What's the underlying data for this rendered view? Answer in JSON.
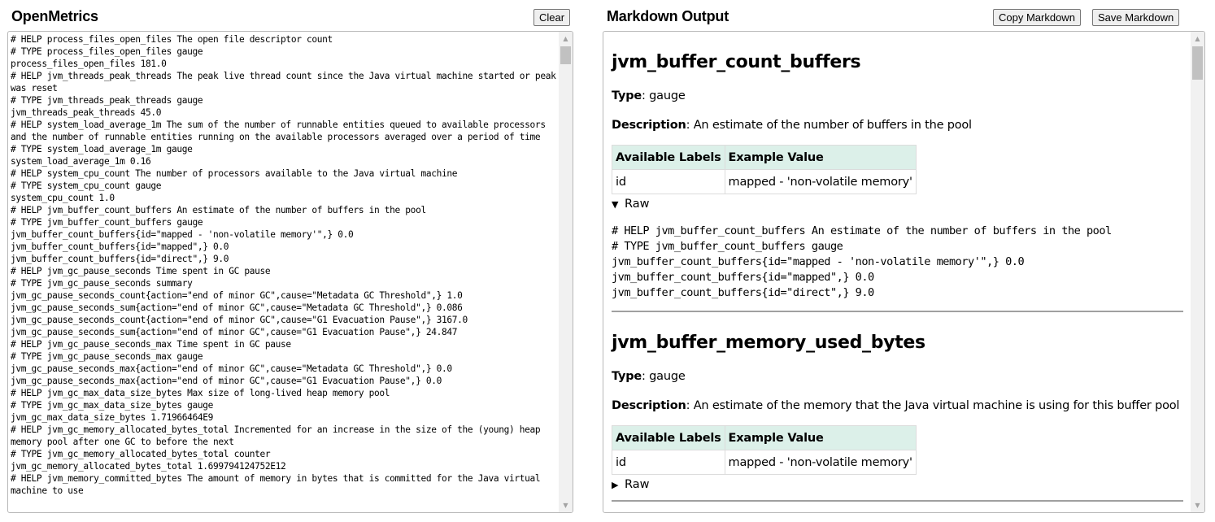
{
  "left_panel": {
    "title": "OpenMetrics",
    "clear_label": "Clear",
    "source_lines": [
      "# HELP process_files_open_files The open file descriptor count",
      "# TYPE process_files_open_files gauge",
      "process_files_open_files 181.0",
      "# HELP jvm_threads_peak_threads The peak live thread count since the Java virtual machine started or peak was reset",
      "# TYPE jvm_threads_peak_threads gauge",
      "jvm_threads_peak_threads 45.0",
      "# HELP system_load_average_1m The sum of the number of runnable entities queued to available processors and the number of runnable entities running on the available processors averaged over a period of time",
      "# TYPE system_load_average_1m gauge",
      "system_load_average_1m 0.16",
      "# HELP system_cpu_count The number of processors available to the Java virtual machine",
      "# TYPE system_cpu_count gauge",
      "system_cpu_count 1.0",
      "# HELP jvm_buffer_count_buffers An estimate of the number of buffers in the pool",
      "# TYPE jvm_buffer_count_buffers gauge",
      "jvm_buffer_count_buffers{id=\"mapped - 'non-volatile memory'\",} 0.0",
      "jvm_buffer_count_buffers{id=\"mapped\",} 0.0",
      "jvm_buffer_count_buffers{id=\"direct\",} 9.0",
      "# HELP jvm_gc_pause_seconds Time spent in GC pause",
      "# TYPE jvm_gc_pause_seconds summary",
      "jvm_gc_pause_seconds_count{action=\"end of minor GC\",cause=\"Metadata GC Threshold\",} 1.0",
      "jvm_gc_pause_seconds_sum{action=\"end of minor GC\",cause=\"Metadata GC Threshold\",} 0.086",
      "jvm_gc_pause_seconds_count{action=\"end of minor GC\",cause=\"G1 Evacuation Pause\",} 3167.0",
      "jvm_gc_pause_seconds_sum{action=\"end of minor GC\",cause=\"G1 Evacuation Pause\",} 24.847",
      "# HELP jvm_gc_pause_seconds_max Time spent in GC pause",
      "# TYPE jvm_gc_pause_seconds_max gauge",
      "jvm_gc_pause_seconds_max{action=\"end of minor GC\",cause=\"Metadata GC Threshold\",} 0.0",
      "jvm_gc_pause_seconds_max{action=\"end of minor GC\",cause=\"G1 Evacuation Pause\",} 0.0",
      "# HELP jvm_gc_max_data_size_bytes Max size of long-lived heap memory pool",
      "# TYPE jvm_gc_max_data_size_bytes gauge",
      "jvm_gc_max_data_size_bytes 1.71966464E9",
      "# HELP jvm_gc_memory_allocated_bytes_total Incremented for an increase in the size of the (young) heap memory pool after one GC to before the next",
      "# TYPE jvm_gc_memory_allocated_bytes_total counter",
      "jvm_gc_memory_allocated_bytes_total 1.699794124752E12",
      "# HELP jvm_memory_committed_bytes The amount of memory in bytes that is committed for the Java virtual machine to use"
    ]
  },
  "right_panel": {
    "title": "Markdown Output",
    "copy_label": "Copy Markdown",
    "save_label": "Save Markdown",
    "type_label": "Type",
    "description_label": "Description",
    "table_headers": [
      "Available Labels",
      "Example Value"
    ],
    "raw_label": "Raw",
    "metrics": [
      {
        "name": "jvm_buffer_count_buffers",
        "type": "gauge",
        "description": "An estimate of the number of buffers in the pool",
        "labels": [
          {
            "label": "id",
            "example": "mapped - 'non-volatile memory'"
          }
        ],
        "raw_expanded": true,
        "raw": "# HELP jvm_buffer_count_buffers An estimate of the number of buffers in the pool\n# TYPE jvm_buffer_count_buffers gauge\njvm_buffer_count_buffers{id=\"mapped - 'non-volatile memory'\",} 0.0\njvm_buffer_count_buffers{id=\"mapped\",} 0.0\njvm_buffer_count_buffers{id=\"direct\",} 9.0"
      },
      {
        "name": "jvm_buffer_memory_used_bytes",
        "type": "gauge",
        "description": "An estimate of the memory that the Java virtual machine is using for this buffer pool",
        "labels": [
          {
            "label": "id",
            "example": "mapped - 'non-volatile memory'"
          }
        ],
        "raw_expanded": false,
        "raw": ""
      }
    ]
  },
  "icons": {
    "scroll_up": "▲",
    "scroll_down": "▼",
    "expanded": "▼",
    "collapsed": "▶"
  }
}
